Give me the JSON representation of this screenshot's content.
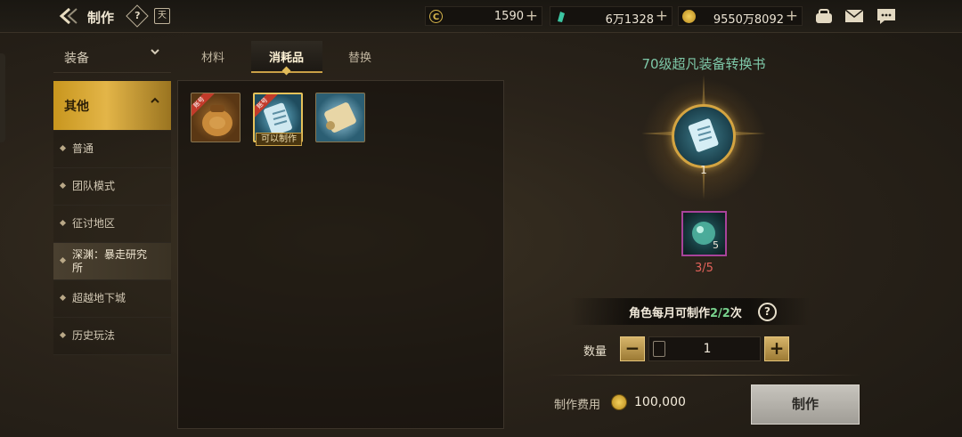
{
  "header": {
    "title": "制作",
    "help_glyph": "?",
    "calendar_glyph": "天"
  },
  "currencies": [
    {
      "name": "gold-coin",
      "icon_glyph": "C",
      "value": "1590",
      "color": "#d8b64c"
    },
    {
      "name": "jade",
      "icon_glyph": "",
      "value": "6万1328",
      "color": "#3cc6a2"
    },
    {
      "name": "gold-bar",
      "icon_glyph": "",
      "value": "9550万8092",
      "color": "#e3b63c"
    }
  ],
  "sidebar": {
    "equip": {
      "label": "装备"
    },
    "other": {
      "label": "其他"
    },
    "items": [
      {
        "label": "普通"
      },
      {
        "label": "团队模式"
      },
      {
        "label": "征讨地区"
      },
      {
        "label": "深渊：暴走研究所"
      },
      {
        "label": "超越地下城"
      },
      {
        "label": "历史玩法"
      }
    ]
  },
  "tabs": [
    {
      "label": "材料"
    },
    {
      "label": "消耗品"
    },
    {
      "label": "替换"
    }
  ],
  "items_panel": {
    "badge_text": "账号",
    "can_make_label": "可以制作"
  },
  "craft": {
    "title": "70级超凡装备转换书",
    "output_count": "1",
    "material_count": "5",
    "material_have": "3/5",
    "limit_prefix": "角色每月可制作",
    "limit_value": "2/2",
    "limit_suffix": "次",
    "limit_help_glyph": "?",
    "qty_label": "数量",
    "qty_value": "1",
    "minus_glyph": "−",
    "plus_glyph": "+",
    "cost_label": "制作费用",
    "cost_value": "100,000",
    "make_label": "制作"
  }
}
